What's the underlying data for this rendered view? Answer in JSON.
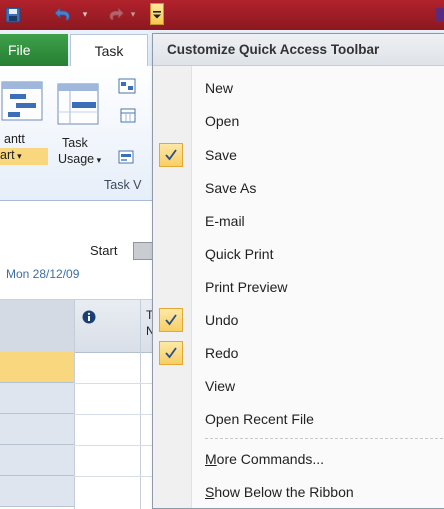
{
  "window": {
    "file_tab": "File",
    "task_tab": "Task"
  },
  "ribbon": {
    "gantt_label_1": "antt",
    "gantt_label_2": "art",
    "task_usage_label_1": "Task",
    "task_usage_label_2": "Usage",
    "task_views_group": "Task V"
  },
  "timeline": {
    "start_label": "Start",
    "start_date": "Mon 28/12/09"
  },
  "grid": {
    "header_col2_fragment": "T",
    "header_col2_fragment2": "N"
  },
  "menu": {
    "title": "Customize Quick Access Toolbar",
    "items": [
      {
        "label": "New",
        "checked": false
      },
      {
        "label": "Open",
        "checked": false
      },
      {
        "label": "Save",
        "checked": true
      },
      {
        "label": "Save As",
        "checked": false
      },
      {
        "label": "E-mail",
        "checked": false
      },
      {
        "label": "Quick Print",
        "checked": false
      },
      {
        "label": "Print Preview",
        "checked": false
      },
      {
        "label": "Undo",
        "checked": true
      },
      {
        "label": "Redo",
        "checked": true
      },
      {
        "label": "View",
        "checked": false
      },
      {
        "label": "Open Recent File",
        "checked": false
      }
    ],
    "more_commands": {
      "mnemonic": "M",
      "rest": "ore Commands..."
    },
    "show_below": {
      "mnemonic": "S",
      "rest": "how Below the Ribbon"
    }
  },
  "colors": {
    "titlebar": "#b1222c",
    "file_tab": "#2e8b3a",
    "check_highlight": "#f8cf64",
    "selected_row": "#f9d77e"
  }
}
